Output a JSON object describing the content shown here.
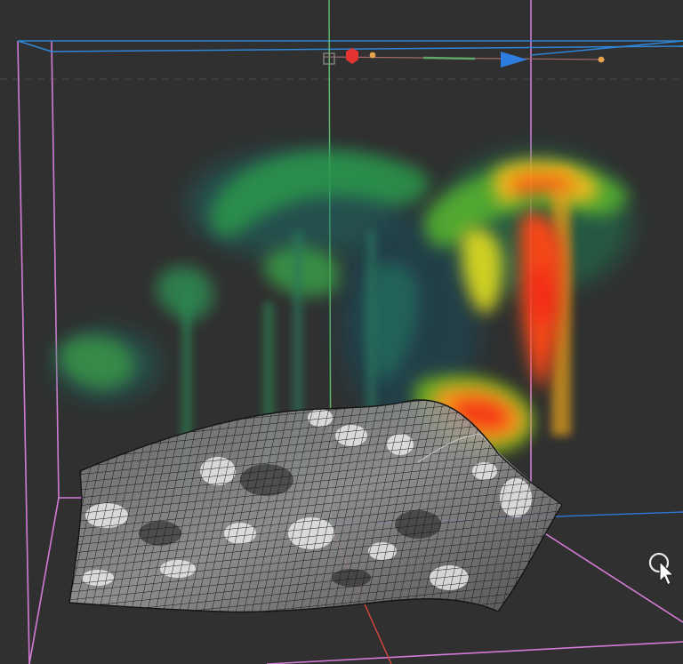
{
  "viewport": {
    "background": "#303030",
    "bounding_box_color": "#d37bd6",
    "axis_colors": {
      "x": "#d9483b",
      "y": "#59b86b",
      "z": "#2f78d6"
    },
    "colormap": [
      "#0b5a6b",
      "#1a8a6a",
      "#3dbb3a",
      "#e3e22b",
      "#ff7a18",
      "#ff2a12"
    ],
    "surface": {
      "type": "wireframe-mesh",
      "texture": "grayscale"
    },
    "volume": {
      "type": "volume-render",
      "colormap_name": "blue-green-yellow-red"
    }
  },
  "gizmo": {
    "light_icon": "light-source-icon",
    "camera_icon": "camera-direction-icon"
  },
  "cursor": {
    "icon": "rotate-cursor-icon"
  }
}
